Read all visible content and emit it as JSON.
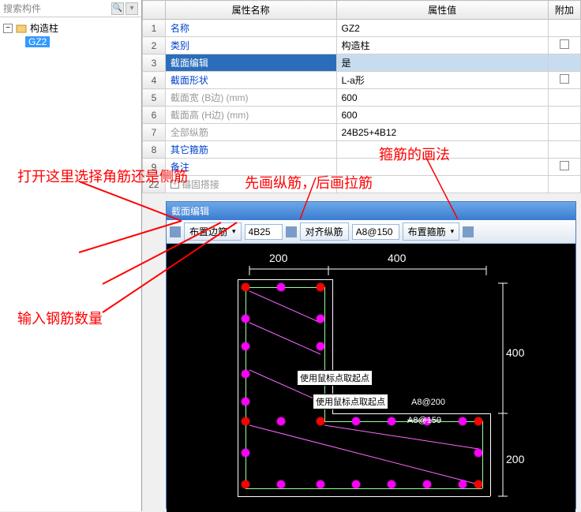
{
  "search": {
    "placeholder": "搜索构件"
  },
  "tree": {
    "root": "构造柱",
    "child": "GZ2"
  },
  "headers": {
    "name": "属性名称",
    "value": "属性值",
    "addon": "附加"
  },
  "rows": [
    {
      "n": "1",
      "name": "名称",
      "val": "GZ2",
      "link": true
    },
    {
      "n": "2",
      "name": "类别",
      "val": "构造柱",
      "link": true,
      "addon": true
    },
    {
      "n": "3",
      "name": "截面编辑",
      "val": "是",
      "link": true,
      "sel": true
    },
    {
      "n": "4",
      "name": "截面形状",
      "val": "L-a形",
      "link": true,
      "addon": true
    },
    {
      "n": "5",
      "name": "截面宽 (B边) (mm)",
      "val": "600",
      "gray": true
    },
    {
      "n": "6",
      "name": "截面高 (H边) (mm)",
      "val": "600",
      "gray": true
    },
    {
      "n": "7",
      "name": "全部纵筋",
      "val": "24B25+4B12",
      "gray": true
    },
    {
      "n": "8",
      "name": "其它箍筋",
      "val": "",
      "link": true
    },
    {
      "n": "9",
      "name": "备注",
      "val": "",
      "link": true,
      "addon": true
    }
  ],
  "row22": {
    "n": "22",
    "name": "锚固搭接"
  },
  "ann": {
    "a1": "打开这里选择角筋还是侧筋",
    "a2": "先画纵筋，后画拉筋",
    "a3": "箍筋的画法",
    "a4": "输入钢筋数量"
  },
  "editor": {
    "title": "截面编辑",
    "btn1": "布置边筋",
    "inp1": "4B25",
    "btn2": "对齐纵筋",
    "inp2": "A8@150",
    "btn3": "布置箍筋",
    "dim200": "200",
    "dim400": "400",
    "dim400b": "400",
    "dim200b": "200",
    "tip1": "使用鼠标点取起点",
    "tip2": "使用鼠标点取起点",
    "lbl1": "A8@200",
    "lbl2": "A8@150"
  }
}
